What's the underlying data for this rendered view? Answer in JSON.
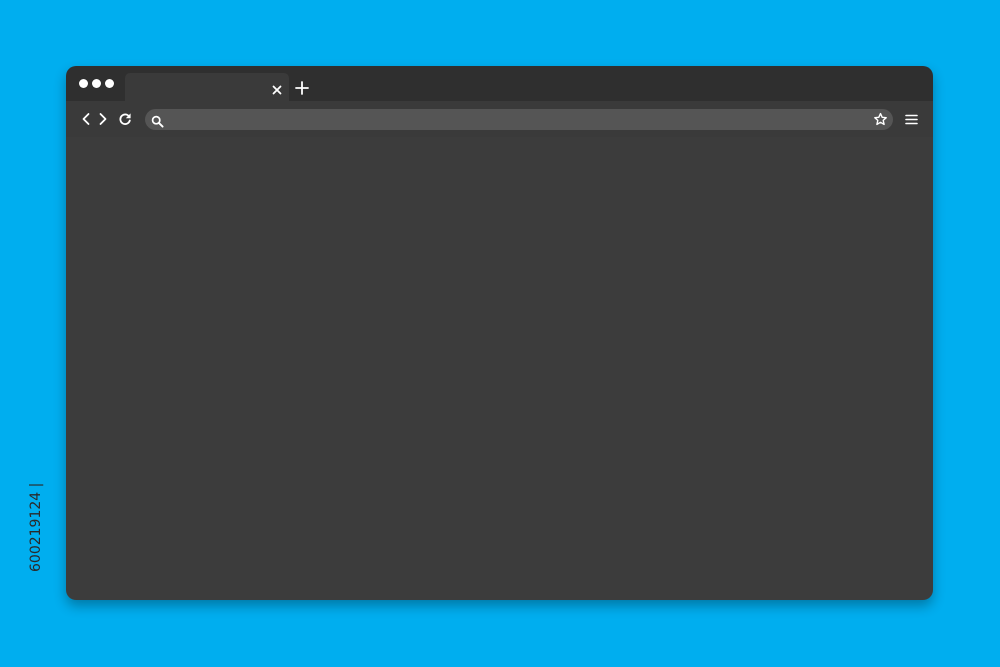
{
  "colors": {
    "backdrop": "#00AEEF",
    "tab_strip": "#2F2F2F",
    "active_tab": "#3A3A3A",
    "toolbar": "#3A3A3A",
    "viewport": "#3C3C3C",
    "address_bar": "#555555",
    "icon": "#FFFFFF",
    "window_dot": "#FFFFFF",
    "label_text": "#2A2A2A"
  },
  "window_controls": [
    {
      "icon": "window-dot"
    },
    {
      "icon": "window-dot"
    },
    {
      "icon": "window-dot"
    }
  ],
  "tab": {
    "title": "",
    "close_icon": "close-icon"
  },
  "new_tab": {
    "icon": "plus-icon"
  },
  "toolbar": {
    "back_icon": "chevron-left-icon",
    "forward_icon": "chevron-right-icon",
    "reload_icon": "reload-icon",
    "menu_icon": "hamburger-menu-icon"
  },
  "address_bar": {
    "search_icon": "search-icon",
    "value": "",
    "placeholder": "",
    "bookmark_icon": "star-icon"
  },
  "image_label": {
    "text": "600219124 | "
  }
}
